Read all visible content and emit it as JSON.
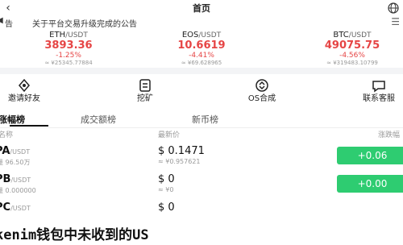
{
  "header": {
    "title": "首页"
  },
  "notice": {
    "prefix": "告",
    "text": "关于平台交易升级完成的公告"
  },
  "tickers": [
    {
      "base": "ETH",
      "quote": "/USDT",
      "price": "3893.36",
      "change": "-1.25%",
      "volume": "≈ ¥25345.77884"
    },
    {
      "base": "EOS",
      "quote": "/USDT",
      "price": "10.6619",
      "change": "-4.41%",
      "volume": "≈ ¥69.628965"
    },
    {
      "base": "BTC",
      "quote": "/USDT",
      "price": "49075.75",
      "change": "-4.56%",
      "volume": "≈ ¥319483.10799"
    }
  ],
  "menu": [
    {
      "label": "邀请好友"
    },
    {
      "label": "挖矿"
    },
    {
      "label": "OS合成"
    },
    {
      "label": "联系客服"
    }
  ],
  "tabs": [
    {
      "label": "涨幅榜"
    },
    {
      "label": "成交额榜"
    },
    {
      "label": "新币榜"
    }
  ],
  "columns": {
    "name": "名称",
    "price": "最新价",
    "change": "涨跌幅"
  },
  "rows": [
    {
      "base": "PA",
      "quote": "/USDT",
      "volume": "量 96.50万",
      "price": "$ 0.1471",
      "sub": "≈ ¥0.957621",
      "change": "+0.06"
    },
    {
      "base": "PB",
      "quote": "/USDT",
      "volume": "量 0.000000",
      "price": "$ 0",
      "sub": "≈ ¥0",
      "change": "+0.00"
    },
    {
      "base": "PC",
      "quote": "/USDT",
      "volume": "",
      "price": "$ 0",
      "sub": "",
      "change": ""
    }
  ],
  "overlay": {
    "text": "kenim钱包中未收到的US"
  },
  "colors": {
    "down": "#e64545",
    "up": "#2ecc71"
  },
  "icons": [
    "back-icon",
    "globe-icon",
    "speaker-icon",
    "more-icon",
    "gift-icon",
    "mining-icon",
    "exchange-icon",
    "chat-icon"
  ]
}
